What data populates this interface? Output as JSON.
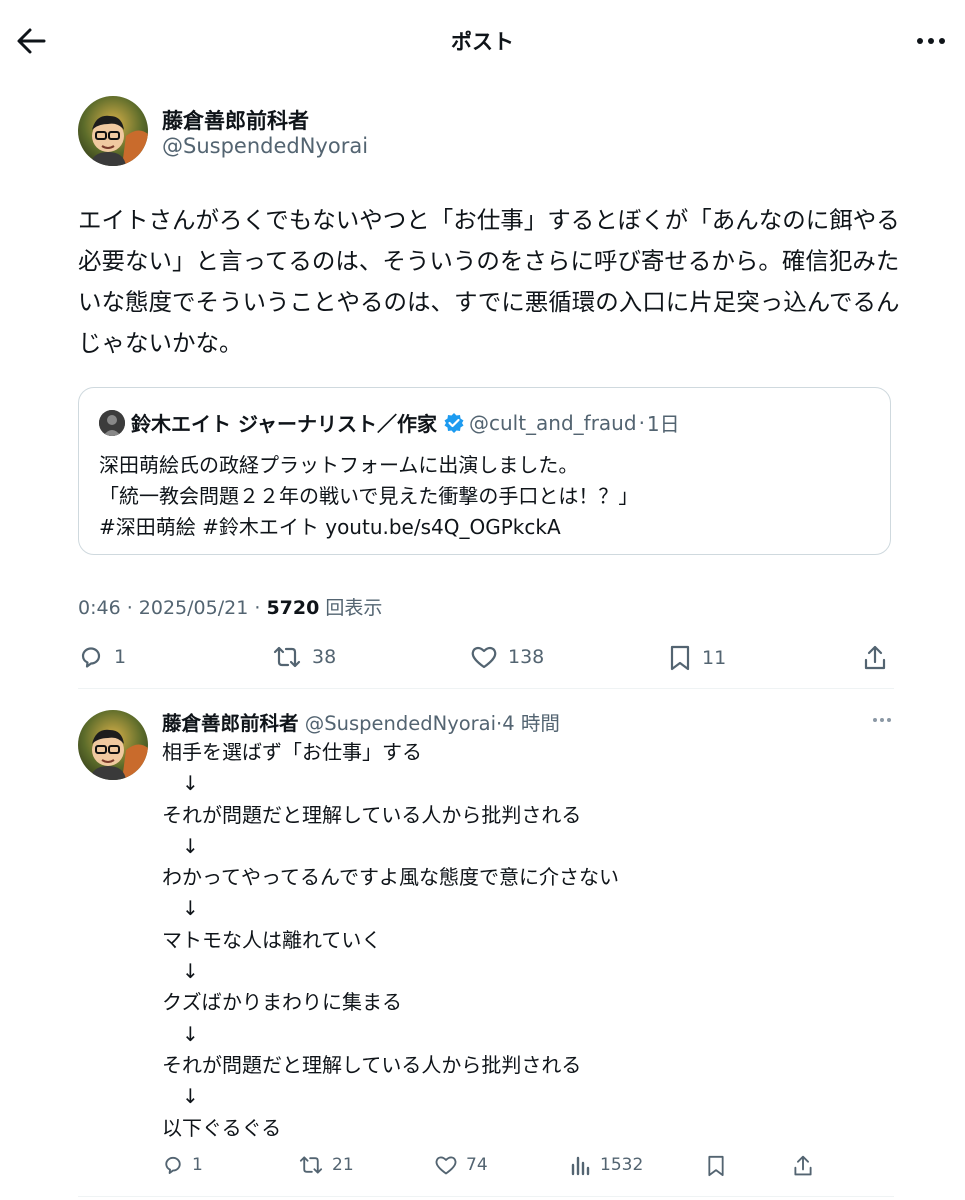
{
  "header": {
    "title": "ポスト",
    "back_icon": "arrow-left-icon",
    "more_icon": "more-vertical-icon"
  },
  "post": {
    "display_name": "藤倉善郎前科者",
    "handle": "@SuspendedNyorai",
    "text": "エイトさんがろくでもないやつと「お仕事」するとぼくが「あんなのに餌やる必要ない」と言ってるのは、そういうのをさらに呼び寄せるから。確信犯みたいな態度でそういうことやるのは、すでに悪循環の入口に片足突っ込んでるんじゃないかな。",
    "quote": {
      "display_name": "鈴木エイト ジャーナリスト／作家",
      "handle": "@cult_and_fraud",
      "time": "1日",
      "text": "深田萌絵氏の政経プラットフォームに出演しました。\n「統一教会問題２２年の戦いで見えた衝撃の手口とは！？」\n#深田萌絵 #鈴木エイト youtu.be/s4Q_OGPkckA"
    },
    "time": "0:46",
    "date": "2025/05/21",
    "views": "5720",
    "views_label": "回表示",
    "actions": {
      "replies": "1",
      "reposts": "38",
      "likes": "138",
      "bookmarks": "11"
    }
  },
  "reply": {
    "display_name": "藤倉善郎前科者",
    "handle": "@SuspendedNyorai",
    "time": "4 時間",
    "text": "相手を選ばず「お仕事」する\n　↓\nそれが問題だと理解している人から批判される\n　↓\nわかってやってるんですよ風な態度で意に介さない\n　↓\nマトモな人は離れていく\n　↓\nクズばかりまわりに集まる\n　↓\nそれが問題だと理解している人から批判される\n　↓\n以下ぐるぐる",
    "actions": {
      "replies": "1",
      "reposts": "21",
      "likes": "74",
      "views": "1532"
    }
  },
  "colors": {
    "text": "#0f1419",
    "secondary": "#536471",
    "border": "#cfd9de",
    "verified": "#1d9bf0"
  }
}
